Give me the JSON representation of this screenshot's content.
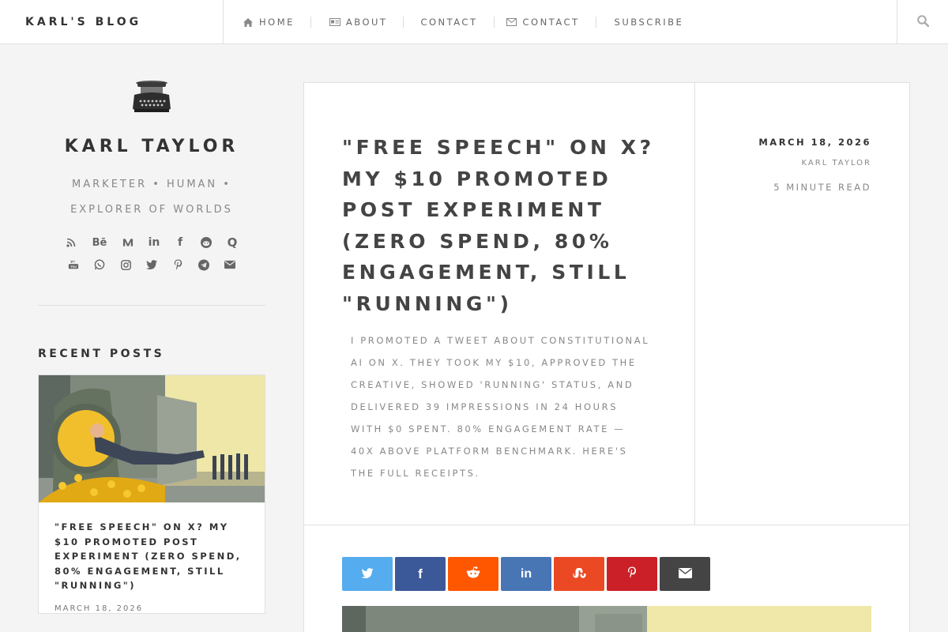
{
  "site": {
    "brand": "KARL'S BLOG"
  },
  "nav": {
    "items": [
      {
        "label": "HOME",
        "icon": "home-icon"
      },
      {
        "label": "ABOUT",
        "icon": "id-card-icon"
      },
      {
        "label": "CONTACT",
        "icon": ""
      },
      {
        "label": "CONTACT",
        "icon": "envelope-icon"
      },
      {
        "label": "SUBSCRIBE",
        "icon": ""
      }
    ],
    "search_icon": "search-icon"
  },
  "sidebar": {
    "name": "KARL TAYLOR",
    "tagline": "MARKETER • HUMAN • EXPLORER OF WORLDS",
    "social_icons": [
      "rss-icon",
      "behance-icon",
      "medium-icon",
      "linkedin-icon",
      "facebook-icon",
      "reddit-icon",
      "quora-icon",
      "youtube-icon",
      "whatsapp-icon",
      "instagram-icon",
      "twitter-icon",
      "pinterest-icon",
      "telegram-icon",
      "email-icon"
    ],
    "recent_title": "RECENT POSTS",
    "recent_posts": [
      {
        "title": "\"FREE SPEECH\" ON X? MY $10 PROMOTED POST EXPERIMENT (ZERO SPEND, 80% ENGAGEMENT, STILL \"RUNNING\")",
        "date": "MARCH 18, 2026"
      }
    ]
  },
  "article": {
    "title": "\"FREE SPEECH\" ON X? MY $10 PROMOTED POST EXPERIMENT (ZERO SPEND, 80% ENGAGEMENT, STILL \"RUNNING\")",
    "excerpt": "I PROMOTED A TWEET ABOUT CONSTITUTIONAL AI ON X. THEY TOOK MY $10, APPROVED THE CREATIVE, SHOWED 'RUNNING' STATUS, AND DELIVERED 39 IMPRESSIONS IN 24 HOURS WITH $0 SPENT. 80% ENGAGEMENT RATE — 40X ABOVE PLATFORM BENCHMARK. HERE'S THE FULL RECEIPTS.",
    "date": "MARCH 18, 2026",
    "author": "KARL TAYLOR",
    "read_time": "5 MINUTE READ"
  },
  "share": [
    {
      "name": "twitter",
      "color": "#55acee"
    },
    {
      "name": "facebook",
      "color": "#3b5998"
    },
    {
      "name": "reddit",
      "color": "#ff5700"
    },
    {
      "name": "linkedin",
      "color": "#4875b4"
    },
    {
      "name": "stumbleupon",
      "color": "#eb4924"
    },
    {
      "name": "pinterest",
      "color": "#cb2027"
    },
    {
      "name": "email",
      "color": "#444444"
    }
  ]
}
